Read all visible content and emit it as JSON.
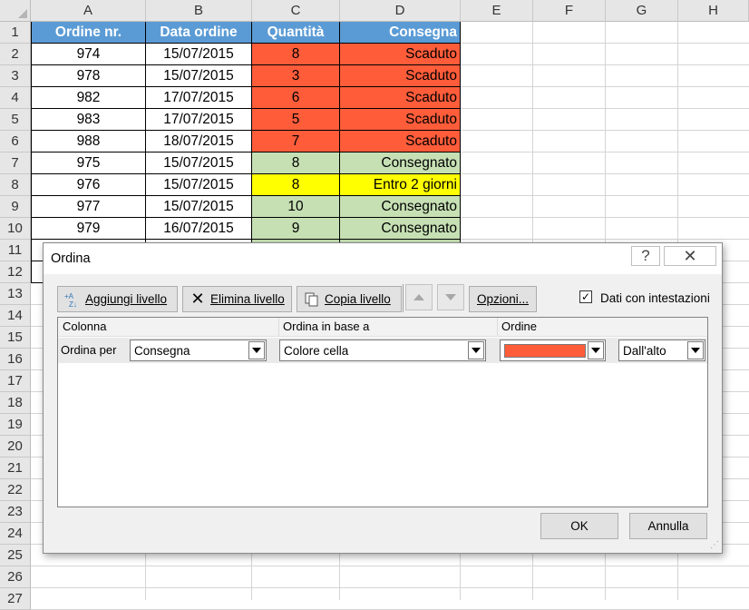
{
  "sheet": {
    "columns": [
      "A",
      "B",
      "C",
      "D",
      "E",
      "F",
      "G",
      "H"
    ],
    "rows": [
      "1",
      "2",
      "3",
      "4",
      "5",
      "6",
      "7",
      "8",
      "9",
      "10",
      "11",
      "12",
      "13",
      "14",
      "15",
      "16",
      "17",
      "18",
      "19",
      "20",
      "21",
      "22",
      "23",
      "24",
      "25",
      "26",
      "27"
    ],
    "headers": {
      "order_no": "Ordine nr.",
      "date": "Data ordine",
      "qty": "Quantità",
      "delivery": "Consegna"
    },
    "data": [
      {
        "order_no": "974",
        "date": "15/07/2015",
        "qty": "8",
        "delivery": "Scaduto",
        "qty_color": "#ff5c3a",
        "delivery_color": "#ff5c3a"
      },
      {
        "order_no": "978",
        "date": "15/07/2015",
        "qty": "3",
        "delivery": "Scaduto",
        "qty_color": "#ff5c3a",
        "delivery_color": "#ff5c3a"
      },
      {
        "order_no": "982",
        "date": "17/07/2015",
        "qty": "6",
        "delivery": "Scaduto",
        "qty_color": "#ff5c3a",
        "delivery_color": "#ff5c3a"
      },
      {
        "order_no": "983",
        "date": "17/07/2015",
        "qty": "5",
        "delivery": "Scaduto",
        "qty_color": "#ff5c3a",
        "delivery_color": "#ff5c3a"
      },
      {
        "order_no": "988",
        "date": "18/07/2015",
        "qty": "7",
        "delivery": "Scaduto",
        "qty_color": "#ff5c3a",
        "delivery_color": "#ff5c3a"
      },
      {
        "order_no": "975",
        "date": "15/07/2015",
        "qty": "8",
        "delivery": "Consegnato",
        "qty_color": "#c6e0b4",
        "delivery_color": "#c6e0b4"
      },
      {
        "order_no": "976",
        "date": "15/07/2015",
        "qty": "8",
        "delivery": "Entro 2 giorni",
        "qty_color": "#ffff00",
        "delivery_color": "#ffff00"
      },
      {
        "order_no": "977",
        "date": "15/07/2015",
        "qty": "10",
        "delivery": "Consegnato",
        "qty_color": "#c6e0b4",
        "delivery_color": "#c6e0b4"
      },
      {
        "order_no": "979",
        "date": "16/07/2015",
        "qty": "9",
        "delivery": "Consegnato",
        "qty_color": "#c6e0b4",
        "delivery_color": "#c6e0b4"
      }
    ],
    "colors": {
      "header_fill": "#5b9bd5",
      "expired": "#ff5c3a",
      "delivered": "#c6e0b4",
      "soon": "#ffff00"
    }
  },
  "dialog": {
    "title": "Ordina",
    "help_icon": "question-icon",
    "close_icon": "close-icon",
    "toolbar": {
      "add_level": "Aggiungi livello",
      "delete_level": "Elimina livello",
      "copy_level": "Copia livello",
      "options": "Opzioni...",
      "headers_checkbox_label": "Dati con intestazioni",
      "headers_checked": true
    },
    "grid": {
      "col_column": "Colonna",
      "col_sort_on": "Ordina in base a",
      "col_order": "Ordine",
      "row_label": "Ordina per",
      "column_value": "Consegna",
      "sort_on_value": "Colore cella",
      "order_color": "#ff5c3a",
      "position_value": "Dall'alto"
    },
    "ok_label": "OK",
    "cancel_label": "Annulla"
  }
}
